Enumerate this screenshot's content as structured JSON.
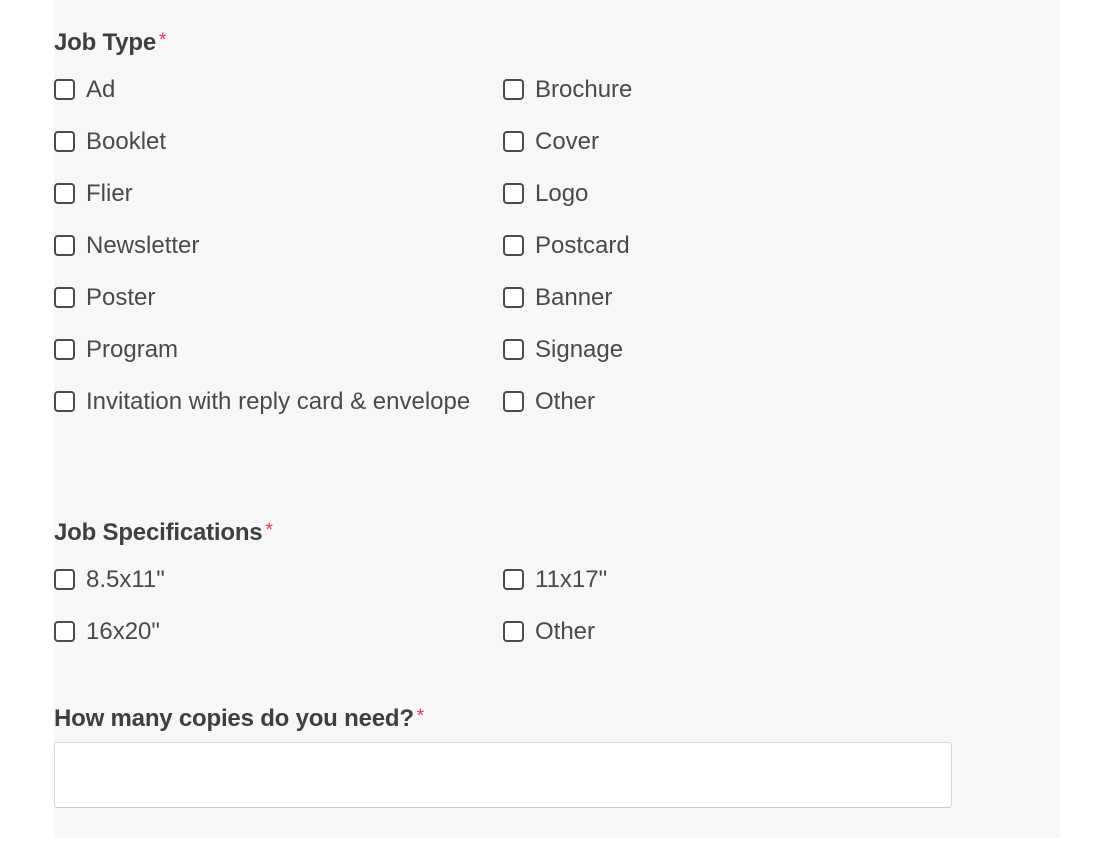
{
  "form": {
    "required_marker": "*",
    "accent_required_color": "#e8384f",
    "panel_background": "#f7f7f7",
    "page_background": "#ffffff",
    "groups": [
      {
        "id": "job-type",
        "label": "Job Type",
        "required": true,
        "columns": {
          "left": [
            "Ad",
            "Booklet",
            "Flier",
            "Newsletter",
            "Poster",
            "Program",
            "Invitation with reply card & envelope"
          ],
          "right": [
            "Brochure",
            "Cover",
            "Logo",
            "Postcard",
            "Banner",
            "Signage",
            "Other"
          ]
        }
      },
      {
        "id": "job-specifications",
        "label": "Job Specifications",
        "required": true,
        "columns": {
          "left": [
            "8.5x11\"",
            "16x20\""
          ],
          "right": [
            "11x17\"",
            "Other"
          ]
        }
      }
    ],
    "copies_question": {
      "label": "How many copies do you need?",
      "required": true,
      "value": "",
      "placeholder": ""
    }
  }
}
